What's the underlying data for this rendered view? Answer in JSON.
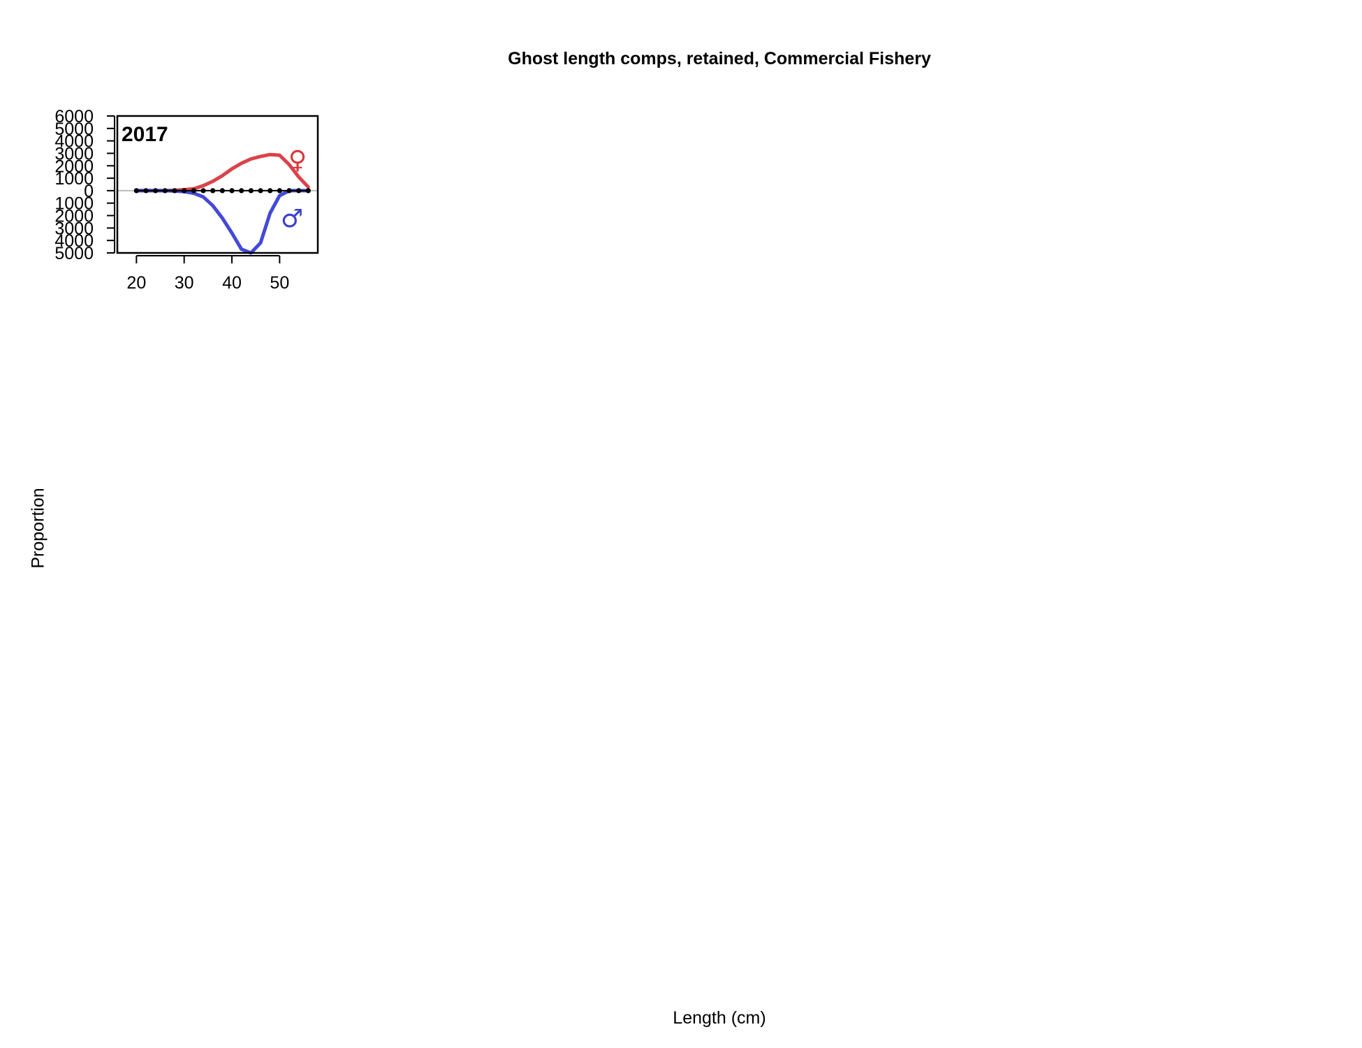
{
  "chart_data": {
    "type": "line",
    "title": "Ghost length comps, retained, Commercial Fishery",
    "xlabel": "Length (cm)",
    "ylabel": "Proportion",
    "panel_label": "2017",
    "xlim": [
      16,
      58
    ],
    "ylim": [
      -5000,
      6000
    ],
    "x_ticks": [
      20,
      30,
      40,
      50
    ],
    "y_ticks_top": [
      6000,
      5000,
      4000,
      3000,
      2000,
      1000,
      0
    ],
    "y_ticks_bottom": [
      1000,
      2000,
      3000,
      4000,
      5000
    ],
    "x": [
      20,
      22,
      24,
      26,
      28,
      30,
      32,
      34,
      36,
      38,
      40,
      42,
      44,
      46,
      48,
      50,
      52,
      54,
      56
    ],
    "series": [
      {
        "name": "♀",
        "color": "#d9383f",
        "values": [
          0,
          0,
          0,
          0,
          30,
          80,
          150,
          400,
          750,
          1200,
          1750,
          2200,
          2550,
          2750,
          2900,
          2850,
          2100,
          1100,
          300
        ]
      },
      {
        "name": "♂",
        "color": "#3a3fd4",
        "values": [
          0,
          0,
          0,
          0,
          -30,
          -80,
          -200,
          -500,
          -1200,
          -2200,
          -3400,
          -4700,
          -5000,
          -4200,
          -1800,
          -400,
          0,
          0,
          0
        ]
      }
    ],
    "observed": [
      0,
      0,
      0,
      0,
      0,
      0,
      0,
      0,
      0,
      0,
      0,
      0,
      0,
      0,
      0,
      0,
      0,
      0,
      0
    ],
    "female_symbol": "♀",
    "male_symbol": "♂",
    "grid": false,
    "legend": "symbols-in-panel"
  }
}
